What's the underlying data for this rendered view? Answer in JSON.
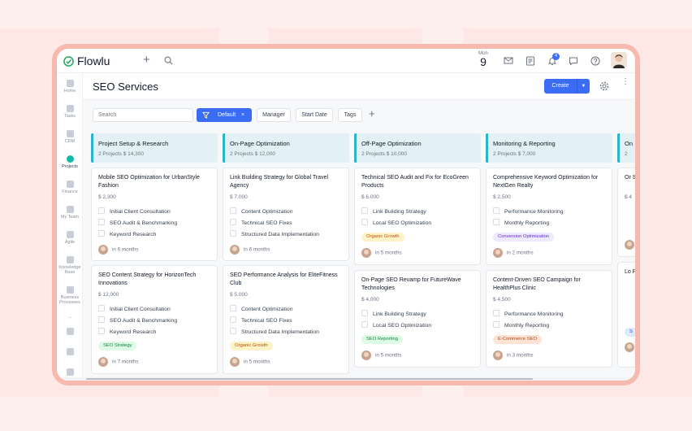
{
  "app": {
    "name": "Flowlu"
  },
  "topbar": {
    "date_month": "Mon",
    "date_day": "9",
    "notification_count": "4",
    "icons": [
      "plus-icon",
      "search-icon",
      "mail-icon",
      "notes-icon",
      "bell-icon",
      "chat-icon",
      "help-icon"
    ]
  },
  "sidebar": {
    "items": [
      {
        "label": "Home",
        "icon": "home-icon"
      },
      {
        "label": "Tasks",
        "icon": "tasks-icon"
      },
      {
        "label": "CRM",
        "icon": "crm-icon"
      },
      {
        "label": "Projects",
        "icon": "projects-icon",
        "active": true
      },
      {
        "label": "Finance",
        "icon": "finance-icon"
      },
      {
        "label": "My Team",
        "icon": "team-icon"
      },
      {
        "label": "Agile",
        "icon": "agile-icon"
      },
      {
        "label": "Knowledge Base",
        "icon": "knowledge-icon"
      },
      {
        "label": "Business Processes",
        "icon": "processes-icon"
      },
      {
        "label": "...",
        "icon": "more-icon"
      }
    ]
  },
  "header": {
    "title": "SEO Services",
    "create_label": "Create"
  },
  "filters": {
    "search_placeholder": "Search",
    "default_label": "Default",
    "default_clear": "×",
    "manager_label": "Manager",
    "start_date_label": "Start Date",
    "tags_label": "Tags",
    "add_label": "+"
  },
  "colors": {
    "accent": "#3b6cf6",
    "column_header": "#e3f1f6",
    "column_stripe": "#2bb5c9"
  },
  "columns": [
    {
      "title": "Project Setup & Research",
      "summary": "2 Projects   $ 14,300",
      "cards": [
        {
          "title": "Mobile SEO Optimization for UrbanStyle Fashion",
          "amount": "$ 2,300",
          "tasks": [
            "Initial Client Consultation",
            "SEO Audit & Benchmarking",
            "Keyword Research"
          ],
          "tag": "",
          "due": "in 6 months"
        },
        {
          "title": "SEO Content Strategy for HorizonTech Innovations",
          "amount": "$ 12,000",
          "tasks": [
            "Initial Client Consultation",
            "SEO Audit & Benchmarking",
            "Keyword Research"
          ],
          "tag": "SEO Strategy",
          "due": "in 7 months"
        }
      ]
    },
    {
      "title": "On-Page Optimization",
      "summary": "2 Projects   $ 12,000",
      "cards": [
        {
          "title": "Link Building Strategy for Global Travel Agency",
          "amount": "$ 7,000",
          "tasks": [
            "Content Optimization",
            "Technical SEO Fixes",
            "Structured Data Implementation"
          ],
          "tag": "",
          "due": "in 6 months"
        },
        {
          "title": "SEO Performance Analysis for EliteFitness Club",
          "amount": "$ 5,000",
          "tasks": [
            "Content Optimization",
            "Technical SEO Fixes",
            "Structured Data Implementation"
          ],
          "tag": "Organic Growth",
          "due": "in 5 months"
        }
      ]
    },
    {
      "title": "Off-Page Optimization",
      "summary": "2 Projects   $ 10,000",
      "cards": [
        {
          "title": "Technical SEO Audit and Fix for EcoGreen Products",
          "amount": "$ 6,000",
          "tasks": [
            "Link Building Strategy",
            "Local SEO Optimization"
          ],
          "tag": "Organic Growth",
          "due": "in 5 months"
        },
        {
          "title": "On-Page SEO Revamp for FutureWave Technologies",
          "amount": "$ 4,000",
          "tasks": [
            "Link Building Strategy",
            "Local SEO Optimization"
          ],
          "tag": "SEO Reporting",
          "due": "in 5 months"
        }
      ]
    },
    {
      "title": "Monitoring & Reporting",
      "summary": "2 Projects   $ 7,000",
      "cards": [
        {
          "title": "Comprehensive Keyword Optimization for NextGen Realty",
          "amount": "$ 2,500",
          "tasks": [
            "Performance Monitoring",
            "Monthly Reporting"
          ],
          "tag": "Conversion Optimization",
          "due": "in 2 months"
        },
        {
          "title": "Content-Driven SEO Campaign for HealthPlus Clinic",
          "amount": "$ 4,500",
          "tasks": [
            "Performance Monitoring",
            "Monthly Reporting"
          ],
          "tag": "E-Commerce SEO",
          "due": "in 3 months"
        }
      ]
    },
    {
      "title": "On",
      "summary": "2",
      "cards": [
        {
          "title": "Or So",
          "amount": "$ 4",
          "tasks": [],
          "tag": "",
          "due": ""
        },
        {
          "title": "Lo Re",
          "amount": "",
          "tasks": [],
          "tag": "S",
          "due": ""
        }
      ]
    }
  ]
}
